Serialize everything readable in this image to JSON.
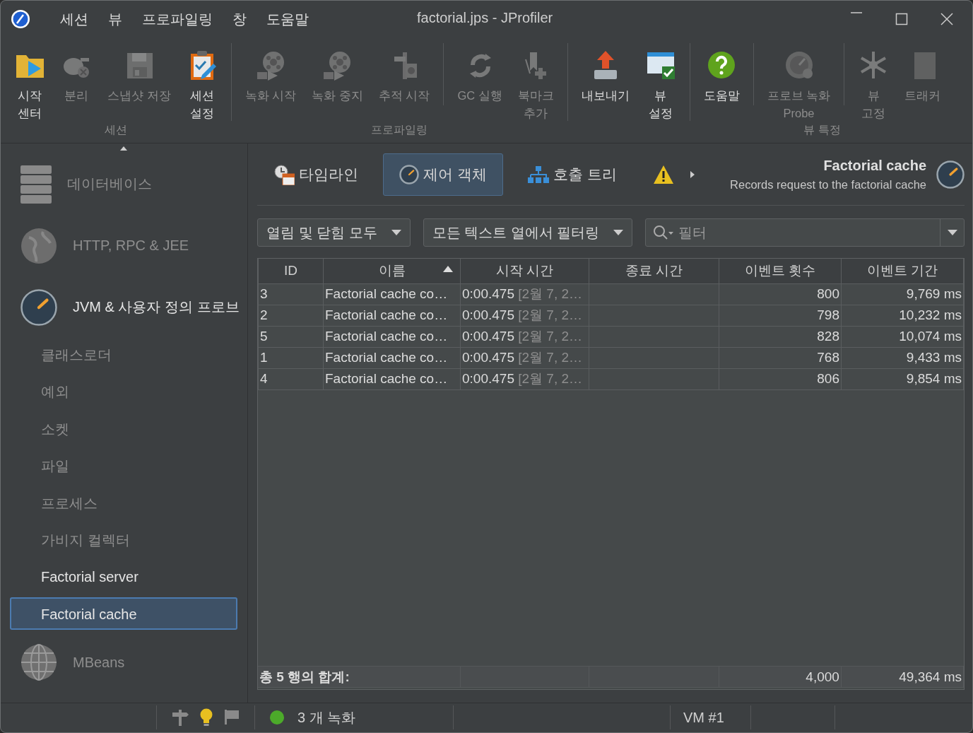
{
  "window": {
    "title": "factorial.jps - JProfiler",
    "menu": [
      "세션",
      "뷰",
      "프로파일링",
      "창",
      "도움말"
    ]
  },
  "ribbon": {
    "groups": [
      {
        "label": "세션",
        "sections": [
          [
            {
              "label": "시작\n센터",
              "disabled": false
            },
            {
              "label": "분리",
              "disabled": true
            },
            {
              "label": "스냅샷 저장",
              "disabled": true
            },
            {
              "label": "세션\n설정",
              "disabled": false
            }
          ]
        ]
      },
      {
        "label": "프로파일링",
        "sections": [
          [
            {
              "label": "녹화 시작",
              "disabled": true
            },
            {
              "label": "녹화 중지",
              "disabled": true
            },
            {
              "label": "추적 시작",
              "disabled": true
            }
          ],
          [
            {
              "label": "GC 실행",
              "disabled": true
            },
            {
              "label": "북마크\n추가",
              "disabled": true
            }
          ]
        ]
      },
      {
        "sections": [
          [
            {
              "label": "내보내기",
              "disabled": false
            },
            {
              "label": "뷰\n설정",
              "disabled": false
            }
          ]
        ]
      },
      {
        "label": "뷰 특정",
        "sections": [
          [
            {
              "label": "도움말",
              "disabled": false
            }
          ],
          [
            {
              "label": "프로브 녹화\nProbe",
              "disabled": true
            }
          ],
          [
            {
              "label": "뷰\n고정",
              "disabled": true
            },
            {
              "label": "트래커",
              "disabled": true
            }
          ]
        ]
      }
    ]
  },
  "sidebar": {
    "items": [
      {
        "label": "데이터베이스",
        "disabled": true,
        "selected": false
      },
      {
        "label": "HTTP, RPC & JEE",
        "disabled": true,
        "selected": false
      },
      {
        "label": "JVM & 사용자 정의 프로브",
        "disabled": false,
        "selected": false,
        "children": [
          {
            "label": "클래스로더",
            "disabled": true,
            "selected": false
          },
          {
            "label": "예외",
            "disabled": true,
            "selected": false
          },
          {
            "label": "소켓",
            "disabled": true,
            "selected": false
          },
          {
            "label": "파일",
            "disabled": true,
            "selected": false
          },
          {
            "label": "프로세스",
            "disabled": true,
            "selected": false
          },
          {
            "label": "가비지 컬렉터",
            "disabled": true,
            "selected": false
          },
          {
            "label": "Factorial server",
            "disabled": false,
            "selected": false
          },
          {
            "label": "Factorial cache",
            "disabled": false,
            "selected": true
          }
        ]
      },
      {
        "label": "MBeans",
        "disabled": true,
        "selected": false
      }
    ]
  },
  "view": {
    "tabs": [
      {
        "label": "타임라인",
        "selected": false
      },
      {
        "label": "제어 객체",
        "selected": true
      },
      {
        "label": "호출 트리",
        "selected": false
      }
    ],
    "title": "Factorial cache",
    "description": "Records request to the factorial cache"
  },
  "filters": {
    "dropdowns": [
      "열림 및 닫힘 모두",
      "모든 텍스트 열에서 필터링"
    ],
    "search": {
      "placeholder": "필터"
    }
  },
  "table": {
    "columns": [
      {
        "label": "ID",
        "sorted": false
      },
      {
        "label": "이름",
        "sorted": true
      },
      {
        "label": "시작 시간",
        "sorted": false
      },
      {
        "label": "종료 시간",
        "sorted": false
      },
      {
        "label": "이벤트 횟수",
        "sorted": false
      },
      {
        "label": "이벤트 기간",
        "sorted": false
      }
    ],
    "rows": [
      {
        "id": "3",
        "name": "Factorial cache co…",
        "start_time": "0:00.475",
        "start_date": "[2월 7, 2…",
        "event_count": "800",
        "event_duration": "9,769 ms"
      },
      {
        "id": "2",
        "name": "Factorial cache co…",
        "start_time": "0:00.475",
        "start_date": "[2월 7, 2…",
        "event_count": "798",
        "event_duration": "10,232 ms"
      },
      {
        "id": "5",
        "name": "Factorial cache co…",
        "start_time": "0:00.475",
        "start_date": "[2월 7, 2…",
        "event_count": "828",
        "event_duration": "10,074 ms"
      },
      {
        "id": "1",
        "name": "Factorial cache co…",
        "start_time": "0:00.475",
        "start_date": "[2월 7, 2…",
        "event_count": "768",
        "event_duration": "9,433 ms"
      },
      {
        "id": "4",
        "name": "Factorial cache co…",
        "start_time": "0:00.475",
        "start_date": "[2월 7, 2…",
        "event_count": "806",
        "event_duration": "9,854 ms"
      }
    ],
    "totals": {
      "label": "총 5 행의 합계:",
      "event_count": "4,000",
      "event_duration": "49,364 ms"
    }
  },
  "status_bar": {
    "recordings": "3 개 녹화",
    "vm": "VM #1"
  }
}
